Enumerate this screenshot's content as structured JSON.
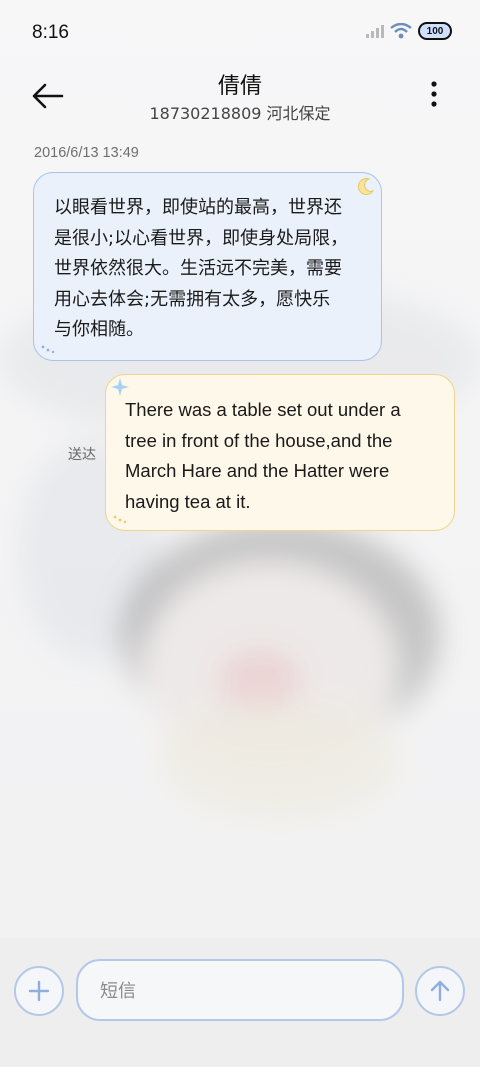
{
  "status_bar": {
    "time": "8:16",
    "battery": "100",
    "icons": [
      "signal-icon",
      "wifi-icon",
      "battery-icon"
    ]
  },
  "header": {
    "contact_name": "倩倩",
    "subtitle": "18730218809 河北保定",
    "back_icon": "back-arrow-icon",
    "more_icon": "more-vertical-icon"
  },
  "conversation": {
    "date": "2016/6/13 13:49",
    "received": {
      "lines": [
        "以眼看世界，即使站的最高，世界还",
        "是很小;以心看世界，即使身处局限，",
        "世界依然很大。生活远不完美，需要",
        "用心去体会;无需拥有太多，愿快乐",
        "与你相随。"
      ]
    },
    "sent": {
      "status": "送达",
      "lines": [
        "There was a table set out under a",
        "tree in front of the house,and the",
        "March Hare and the Hatter were",
        "having tea at it."
      ]
    }
  },
  "compose": {
    "placeholder": "短信",
    "add_icon": "plus-icon",
    "send_icon": "send-arrow-icon"
  },
  "colors": {
    "received_bg": "#eaf1fb",
    "received_border": "#a9c3ea",
    "sent_bg": "#fdf8ea",
    "sent_border": "#f1d48b",
    "accent": "#b3c8e8"
  }
}
